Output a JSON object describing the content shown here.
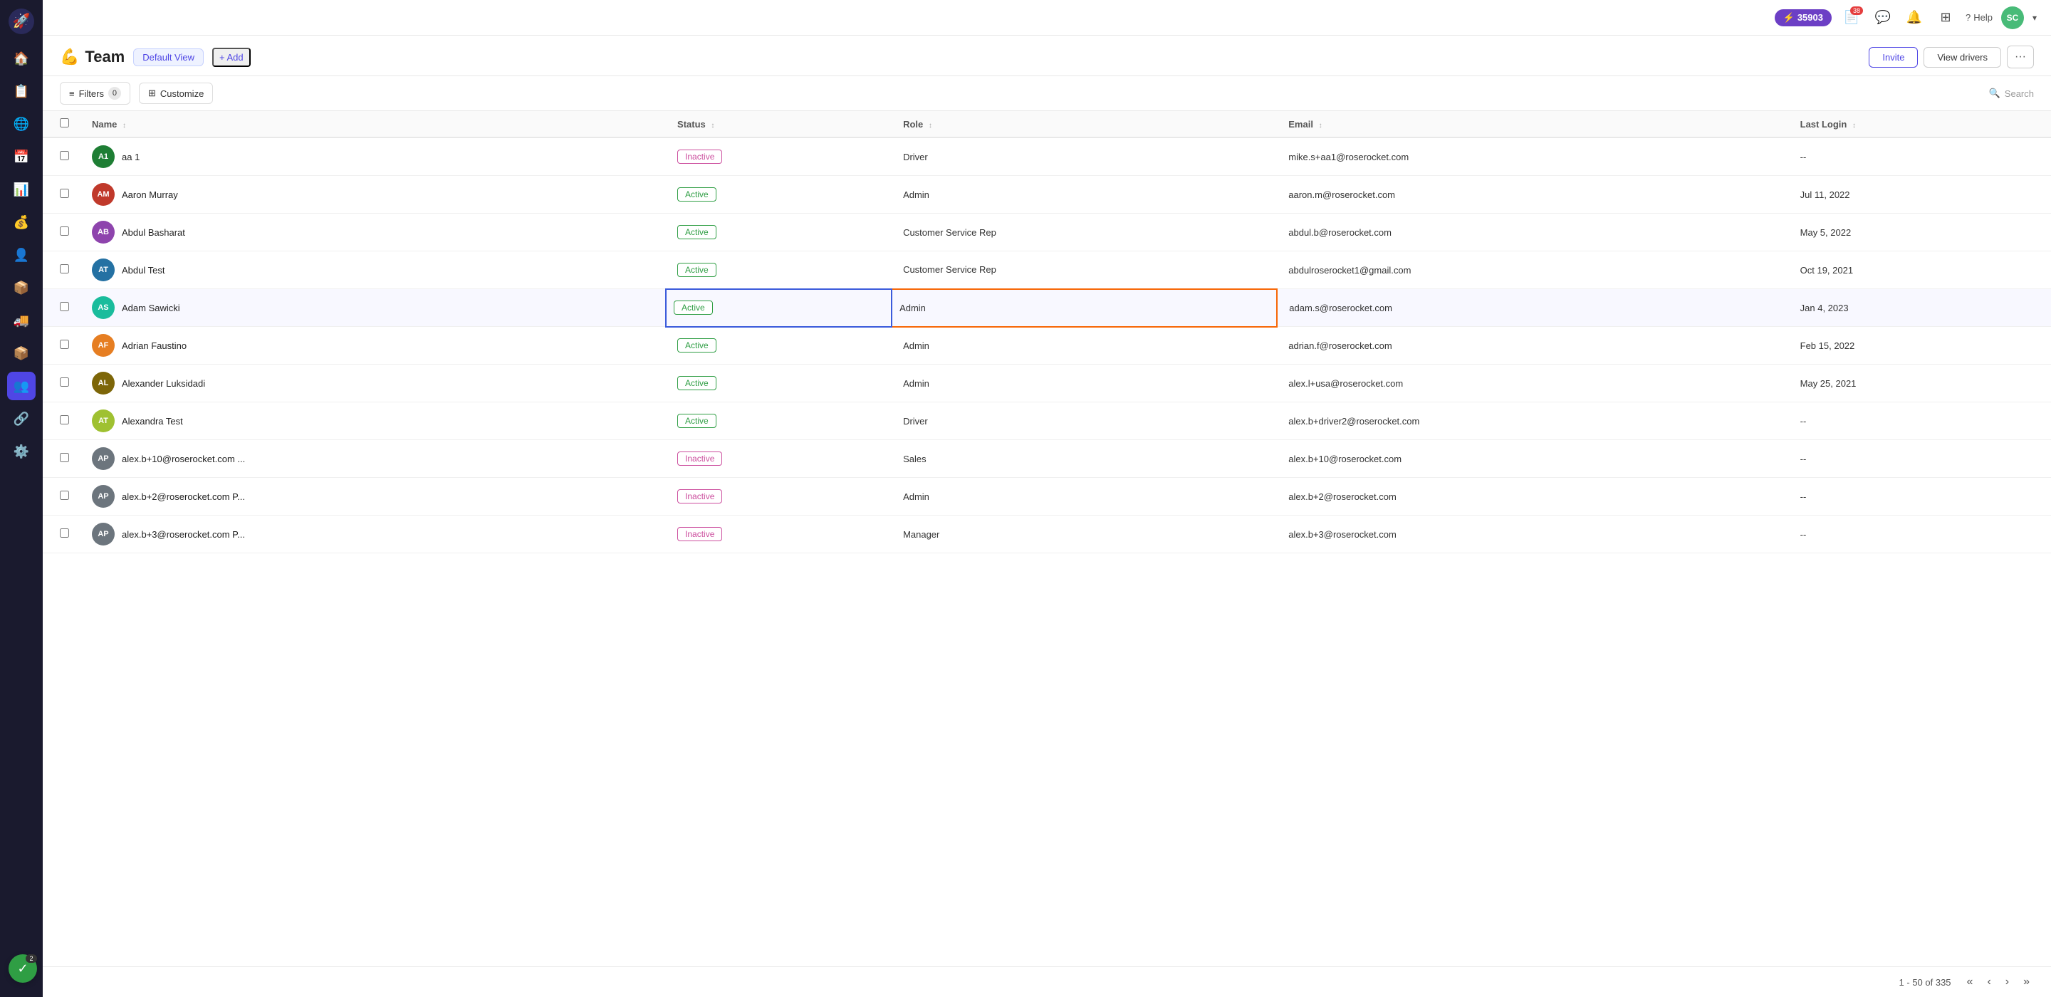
{
  "app": {
    "logo_icon": "🚀"
  },
  "topnav": {
    "points_icon": "⚡",
    "points": "35903",
    "messages_badge": "38",
    "chat_icon": "💬",
    "bell_icon": "🔔",
    "grid_icon": "⊞",
    "help_icon": "?",
    "help_label": "Help",
    "avatar_initials": "SC",
    "caret": "▾"
  },
  "page": {
    "title_icon": "💪",
    "title": "Team",
    "view_label": "Default View",
    "add_label": "+ Add",
    "invite_label": "Invite",
    "view_drivers_label": "View drivers",
    "more_label": "···"
  },
  "toolbar": {
    "filter_icon": "≡",
    "filter_label": "Filters",
    "filter_count": "0",
    "customize_icon": "⊞",
    "customize_label": "Customize",
    "search_icon": "🔍",
    "search_label": "Search"
  },
  "table": {
    "columns": [
      {
        "key": "checkbox",
        "label": ""
      },
      {
        "key": "name",
        "label": "Name"
      },
      {
        "key": "status",
        "label": "Status"
      },
      {
        "key": "role",
        "label": "Role"
      },
      {
        "key": "email",
        "label": "Email"
      },
      {
        "key": "last_login",
        "label": "Last Login"
      }
    ],
    "rows": [
      {
        "initials": "A1",
        "color": "#1e7e34",
        "name": "aa 1",
        "status": "Inactive",
        "status_type": "inactive",
        "role": "Driver",
        "email": "mike.s+aa1@roserocket.com",
        "last_login": "--",
        "highlight_status": false,
        "highlight_role": false
      },
      {
        "initials": "AM",
        "color": "#c0392b",
        "name": "Aaron Murray",
        "status": "Active",
        "status_type": "active",
        "role": "Admin",
        "email": "aaron.m@roserocket.com",
        "last_login": "Jul 11, 2022",
        "highlight_status": false,
        "highlight_role": false
      },
      {
        "initials": "AB",
        "color": "#8e44ad",
        "name": "Abdul Basharat",
        "status": "Active",
        "status_type": "active",
        "role": "Customer Service Rep",
        "email": "abdul.b@roserocket.com",
        "last_login": "May 5, 2022",
        "highlight_status": false,
        "highlight_role": false
      },
      {
        "initials": "AT",
        "color": "#2471a3",
        "name": "Abdul Test",
        "status": "Active",
        "status_type": "active",
        "role": "Customer Service Rep",
        "email": "abdulroserocket1@gmail.com",
        "last_login": "Oct 19, 2021",
        "highlight_status": false,
        "highlight_role": false
      },
      {
        "initials": "AS",
        "color": "#1abc9c",
        "name": "Adam Sawicki",
        "status": "Active",
        "status_type": "active",
        "role": "Admin",
        "email": "adam.s@roserocket.com",
        "last_login": "Jan 4, 2023",
        "highlight_status": true,
        "highlight_role": true
      },
      {
        "initials": "AF",
        "color": "#e67e22",
        "name": "Adrian Faustino",
        "status": "Active",
        "status_type": "active",
        "role": "Admin",
        "email": "adrian.f@roserocket.com",
        "last_login": "Feb 15, 2022",
        "highlight_status": false,
        "highlight_role": false
      },
      {
        "initials": "AL",
        "color": "#7d6608",
        "name": "Alexander Luksidadi",
        "status": "Active",
        "status_type": "active",
        "role": "Admin",
        "email": "alex.l+usa@roserocket.com",
        "last_login": "May 25, 2021",
        "highlight_status": false,
        "highlight_role": false
      },
      {
        "initials": "AT",
        "color": "#9fc131",
        "name": "Alexandra Test",
        "status": "Active",
        "status_type": "active",
        "role": "Driver",
        "email": "alex.b+driver2@roserocket.com",
        "last_login": "--",
        "highlight_status": false,
        "highlight_role": false
      },
      {
        "initials": "AP",
        "color": "#6c757d",
        "name": "alex.b+10@roserocket.com ...",
        "status": "Inactive",
        "status_type": "inactive",
        "role": "Sales",
        "email": "alex.b+10@roserocket.com",
        "last_login": "--",
        "highlight_status": false,
        "highlight_role": false
      },
      {
        "initials": "AP",
        "color": "#6c757d",
        "name": "alex.b+2@roserocket.com P...",
        "status": "Inactive",
        "status_type": "inactive",
        "role": "Admin",
        "email": "alex.b+2@roserocket.com",
        "last_login": "--",
        "highlight_status": false,
        "highlight_role": false
      },
      {
        "initials": "AP",
        "color": "#6c757d",
        "name": "alex.b+3@roserocket.com P...",
        "status": "Inactive",
        "status_type": "inactive",
        "role": "Manager",
        "email": "alex.b+3@roserocket.com",
        "last_login": "--",
        "highlight_status": false,
        "highlight_role": false
      }
    ]
  },
  "pagination": {
    "info": "1 - 50 of 335",
    "first": "«",
    "prev": "‹",
    "next": "›",
    "last": "»"
  },
  "notification": {
    "icon": "✓",
    "count": "2"
  },
  "sidebar": {
    "items": [
      {
        "icon": "🏠",
        "label": "home",
        "active": false
      },
      {
        "icon": "📋",
        "label": "orders",
        "active": false
      },
      {
        "icon": "🌐",
        "label": "network",
        "active": false
      },
      {
        "icon": "📅",
        "label": "calendar",
        "active": false
      },
      {
        "icon": "📊",
        "label": "reports",
        "active": false
      },
      {
        "icon": "💰",
        "label": "finance",
        "active": false
      },
      {
        "icon": "👤",
        "label": "contacts",
        "active": false
      },
      {
        "icon": "📦",
        "label": "shipments",
        "active": false
      },
      {
        "icon": "🚚",
        "label": "fleet",
        "active": false
      },
      {
        "icon": "📦",
        "label": "packages",
        "active": false
      },
      {
        "icon": "👥",
        "label": "team",
        "active": true
      },
      {
        "icon": "🔗",
        "label": "integrations",
        "active": false
      },
      {
        "icon": "⚙️",
        "label": "settings",
        "active": false
      }
    ]
  }
}
